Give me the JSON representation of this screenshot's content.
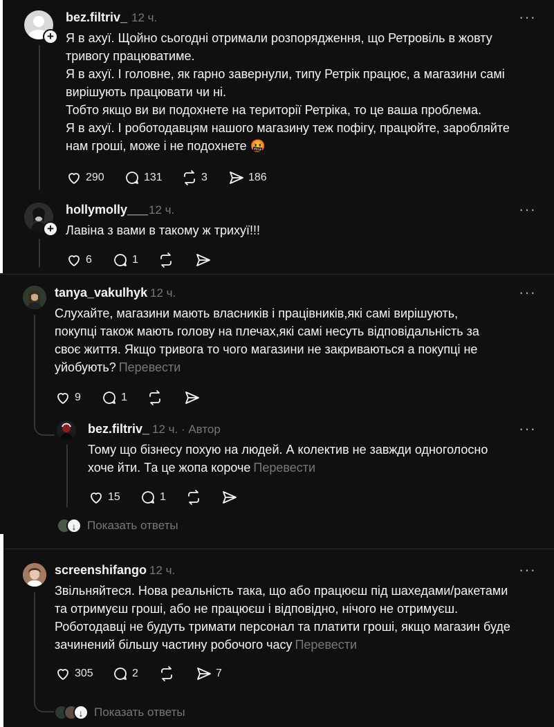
{
  "comments": [
    {
      "username": "bez.filtriv_",
      "time": "12 ч.",
      "lines": [
        "Я в ахуї. Щойно сьогодні отримали розпорядження, що Ретровіль в жовту",
        "тривогу працюватиме.",
        "Я в ахуї. І головне, як гарно завернули, типу Ретрік працює, а магазини самі",
        "вирішують працювати чи ні.",
        "Тобто якщо ви ви подохнете на території Ретріка, то це ваша проблема.",
        "Я в ахуї. І роботодавцям нашого магазину теж пофігу, працюйте, заробляйте",
        "нам гроші, може і не подохнете"
      ],
      "emoji": "🤬",
      "likes": "290",
      "replies": "131",
      "reposts": "3",
      "shares": "186"
    },
    {
      "username": "hollymolly___",
      "time": "12 ч.",
      "lines": [
        "Лавіна з вами в такому ж трихуї!!!"
      ],
      "likes": "6",
      "replies": "1"
    },
    {
      "username": "tanya_vakulhyk",
      "time": "12 ч.",
      "lines": [
        "Слухайте, магазини мають власників і працівників,які самі вирішують,",
        "покупці також мають голову на плечах,які самі несуть відповідальність за",
        "своє життя. Якщо тривога то чого магазини не закриваються а покупці не",
        "уйобують?"
      ],
      "translate": "Перевести",
      "likes": "9",
      "replies": "1"
    },
    {
      "username": "bez.filtriv_",
      "time": "12 ч.",
      "author_badge": "· Автор",
      "lines": [
        "Тому що бізнесу похую на людей. А колектив не завжди одноголосно",
        "хоче йти. Та це жопа короче"
      ],
      "translate": "Перевести",
      "likes": "15",
      "replies": "1"
    },
    {
      "username": "screenshifango",
      "time": "12 ч.",
      "lines": [
        "Звільняйтеся. Нова реальність така, що або працюєш під шахедами/ракетами",
        "та отримуєш гроші, або не працюєш і відповідно, нічого не отримуєш.",
        "Роботодавці не будуть тримати персонал та платити гроші, якщо магазин буде",
        "зачинений більшу частину робочого часу"
      ],
      "translate": "Перевести",
      "likes": "305",
      "replies": "2",
      "shares": "7"
    }
  ],
  "show_replies_label": "Показать ответы",
  "more_label": "···",
  "add_label": "+",
  "arrow_label": "↓",
  "colors": {
    "background": "#101010",
    "text": "#f3f5f7",
    "muted": "#777777",
    "line": "#333638"
  },
  "icons": [
    "heart-icon",
    "comment-icon",
    "repost-icon",
    "share-icon",
    "more-icon",
    "follow-plus-icon"
  ]
}
